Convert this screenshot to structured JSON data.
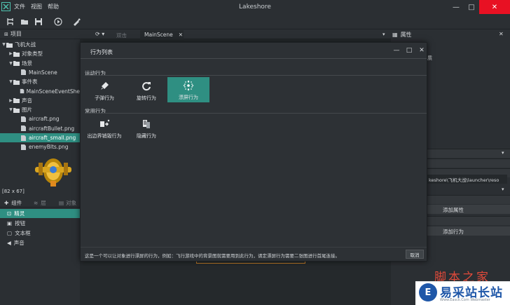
{
  "app": {
    "title": "Lakeshore",
    "menu": [
      "文件",
      "视图",
      "帮助"
    ],
    "win_controls": [
      "—",
      "□",
      "✕"
    ]
  },
  "toolbar": {
    "icons": [
      "new-project-icon",
      "open-folder-icon",
      "save-icon",
      "play-icon",
      "build-icon"
    ]
  },
  "project_panel": {
    "title": "项目",
    "tree": [
      {
        "label": "飞机大战",
        "level": 0,
        "expanded": true,
        "kind": "project"
      },
      {
        "label": "对象类型",
        "level": 1,
        "expanded": false,
        "kind": "folder"
      },
      {
        "label": "场景",
        "level": 1,
        "expanded": true,
        "kind": "folder"
      },
      {
        "label": "MainScene",
        "level": 2,
        "kind": "file"
      },
      {
        "label": "事件表",
        "level": 1,
        "expanded": true,
        "kind": "folder"
      },
      {
        "label": "MainSceneEventShe",
        "level": 2,
        "kind": "file"
      },
      {
        "label": "声音",
        "level": 1,
        "kind": "folder"
      },
      {
        "label": "图片",
        "level": 1,
        "expanded": true,
        "kind": "folder"
      },
      {
        "label": "aircraft.png",
        "level": 2,
        "kind": "file"
      },
      {
        "label": "aircraftBullet.png",
        "level": 2,
        "kind": "file"
      },
      {
        "label": "aircraft_small.png",
        "level": 2,
        "kind": "file",
        "selected": true
      },
      {
        "label": "enemyBlts.png",
        "level": 2,
        "kind": "file"
      }
    ],
    "image_size": "[82 x 67]"
  },
  "component_panel": {
    "tabs": [
      "组件",
      "层",
      "对象"
    ],
    "items": [
      "精灵",
      "按钮",
      "文本框",
      "声音"
    ]
  },
  "editor": {
    "tabs": [
      "双击",
      "MainScene"
    ]
  },
  "right_panel": {
    "title": "属性",
    "path_text": "keshore\\飞机大战\\launcher\\reso",
    "add_property": "添加属性",
    "add_behavior": "添加行为"
  },
  "dialog": {
    "title": "行为列表",
    "section_motion": "运动行为",
    "section_common": "常用行为",
    "motion_actions": [
      {
        "label": "子弹行为",
        "icon": "bullet-icon",
        "active": false
      },
      {
        "label": "旋转行为",
        "icon": "rotate-icon",
        "active": false
      },
      {
        "label": "漂屏行为",
        "icon": "wrap-screen-icon",
        "active": true
      }
    ],
    "common_actions": [
      {
        "label": "出边界销毁行为",
        "icon": "destroy-outside-icon"
      },
      {
        "label": "隐藏行为",
        "icon": "hide-icon"
      }
    ],
    "footer_text": "这是一个可以让对象进行漂屏的行为，例如：飞行游戏中的背景图就需要用到此行为，请定漂屏行为需要二张图进行首尾连接。",
    "cancel": "取消"
  },
  "watermark": {
    "top": "脚本之家",
    "main": "易采站长站",
    "sub": "Www.Easck.Com Webmaster",
    "logo": "E"
  },
  "colors": {
    "accent": "#2f8f82",
    "background": "#2b2f33",
    "close": "#e81123"
  }
}
